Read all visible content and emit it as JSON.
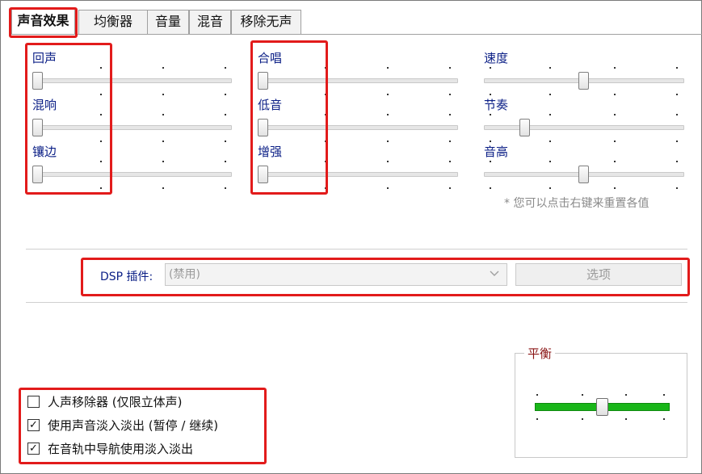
{
  "tabs": [
    {
      "label": "声音效果",
      "active": true
    },
    {
      "label": "均衡器",
      "active": false
    },
    {
      "label": "音量",
      "active": false
    },
    {
      "label": "混音",
      "active": false
    },
    {
      "label": "移除无声",
      "active": false
    }
  ],
  "sliders": {
    "col1": [
      {
        "label": "回声",
        "value": 0
      },
      {
        "label": "混响",
        "value": 0
      },
      {
        "label": "镶边",
        "value": 0
      }
    ],
    "col2": [
      {
        "label": "合唱",
        "value": 0
      },
      {
        "label": "低音",
        "value": 0
      },
      {
        "label": "增强",
        "value": 0
      }
    ],
    "col3": [
      {
        "label": "速度",
        "value": 0.5
      },
      {
        "label": "节奏",
        "value": 0.19
      },
      {
        "label": "音高",
        "value": 0.5
      }
    ]
  },
  "hint": "* 您可以点击右键来重置各值",
  "dsp": {
    "label": "DSP 插件:",
    "selected": "(禁用)",
    "options_button": "选项"
  },
  "checkboxes": [
    {
      "label": "人声移除器 (仅限立体声)",
      "checked": false
    },
    {
      "label": "使用声音淡入淡出 (暂停 / 继续)",
      "checked": true
    },
    {
      "label": "在音轨中导航使用淡入淡出",
      "checked": true
    }
  ],
  "balance": {
    "title": "平衡",
    "value": 0.5
  },
  "colors": {
    "highlight": "#e21b1b",
    "label_blue": "#0b1f86",
    "balance_green": "#19b619"
  },
  "icons": {
    "dropdown": "chevron-down-icon",
    "checkbox_checked": "check-icon"
  }
}
